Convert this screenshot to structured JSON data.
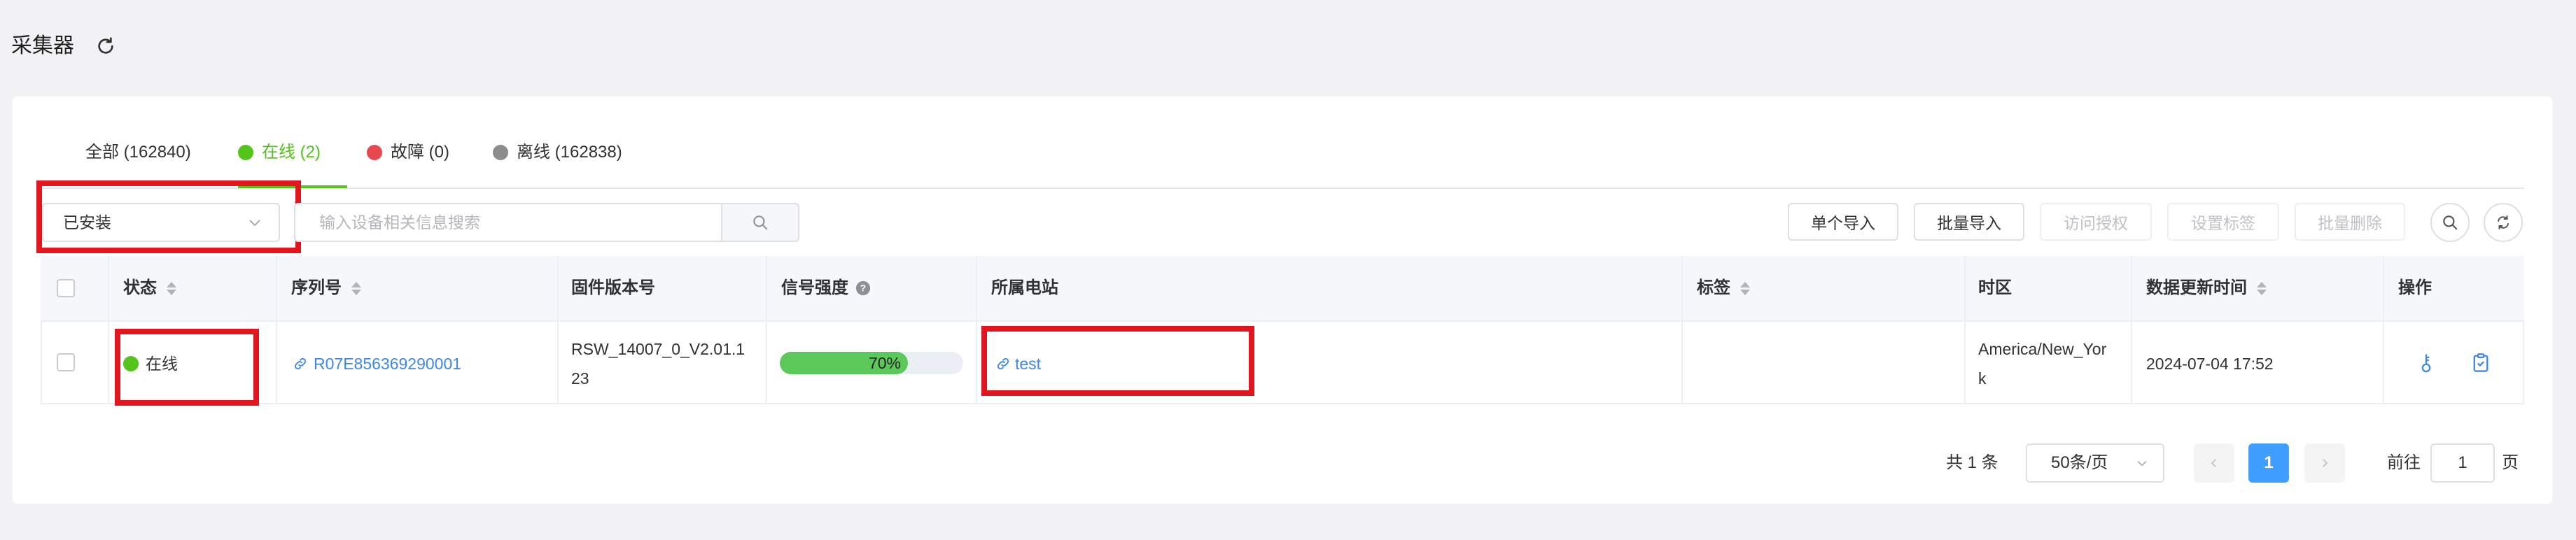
{
  "header": {
    "title": "采集器",
    "refresh_icon": "refresh-icon"
  },
  "tabs": [
    {
      "label": "全部 (162840)",
      "dot": null
    },
    {
      "label": "在线 (2)",
      "dot": "#52c41a",
      "active": true
    },
    {
      "label": "故障 (0)",
      "dot": "#e5484d"
    },
    {
      "label": "离线 (162838)",
      "dot": "#8c8c8c"
    }
  ],
  "filters": {
    "status_select_value": "已安装",
    "search_placeholder": "输入设备相关信息搜索"
  },
  "toolbar": {
    "single_import": "单个导入",
    "batch_import": "批量导入",
    "access_auth": "访问授权",
    "set_tags": "设置标签",
    "batch_delete": "批量删除"
  },
  "table": {
    "headers": {
      "status": "状态",
      "serial": "序列号",
      "firmware": "固件版本号",
      "signal": "信号强度",
      "station": "所属电站",
      "tags": "标签",
      "timezone": "时区",
      "updated": "数据更新时间",
      "actions": "操作"
    },
    "rows": [
      {
        "status": "在线",
        "status_color": "#52c41a",
        "serial": "R07E856369290001",
        "firmware_line1": "RSW_14007_0_V2.01.1",
        "firmware_line2": "23",
        "signal_percent": 70,
        "signal_label": "70%",
        "station": "test",
        "tags": "",
        "timezone_line1": "America/New_Yor",
        "timezone_line2": "k",
        "updated": "2024-07-04 17:52"
      }
    ]
  },
  "pagination": {
    "total_text": "共 1 条",
    "page_size": "50条/页",
    "current_page": "1",
    "goto_prefix": "前往",
    "goto_value": "1",
    "goto_suffix": "页"
  },
  "colors": {
    "accent": "#409eff",
    "online": "#52c41a",
    "highlight": "#e3161f",
    "link": "#3f87e6"
  }
}
